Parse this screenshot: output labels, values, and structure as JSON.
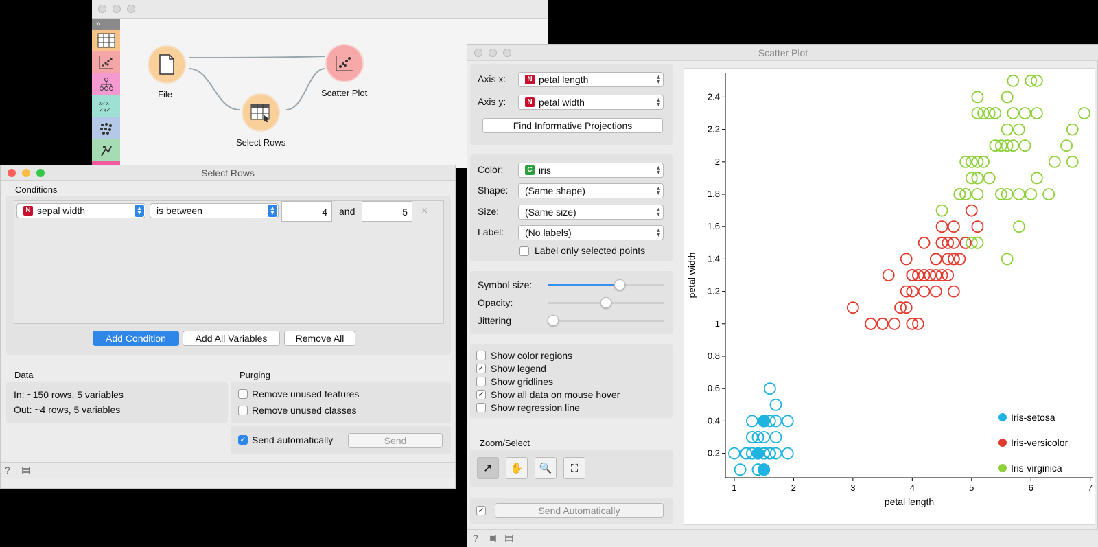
{
  "canvas": {
    "nodes": {
      "file": "File",
      "select_rows": "Select Rows",
      "scatter_plot": "Scatter Plot"
    }
  },
  "select_rows": {
    "title": "Select Rows",
    "conditions_label": "Conditions",
    "condition": {
      "variable": "sepal width",
      "operator": "is between",
      "value_from": "4",
      "and_label": "and",
      "value_to": "5",
      "remove": "×"
    },
    "buttons": {
      "add_condition": "Add Condition",
      "add_all": "Add All Variables",
      "remove_all": "Remove All"
    },
    "data": {
      "label": "Data",
      "in": "In: ~150 rows, 5 variables",
      "out": "Out: ~4 rows, 5 variables"
    },
    "purging": {
      "label": "Purging",
      "features": "Remove unused features",
      "classes": "Remove unused classes"
    },
    "send_auto": "Send automatically",
    "send": "Send"
  },
  "scatter": {
    "title": "Scatter Plot",
    "axis_x_label": "Axis x:",
    "axis_x": "petal length",
    "axis_y_label": "Axis y:",
    "axis_y": "petal width",
    "find_projections": "Find Informative Projections",
    "color_label": "Color:",
    "color": "iris",
    "shape_label": "Shape:",
    "shape": "(Same shape)",
    "size_label": "Size:",
    "size": "(Same size)",
    "label_label": "Label:",
    "label": "(No labels)",
    "label_selected": "Label only selected points",
    "symbol_size": "Symbol size:",
    "opacity": "Opacity:",
    "jittering": "Jittering",
    "symbol_size_value": 0.62,
    "opacity_value": 0.5,
    "jittering_value": 0.0,
    "show_color_regions": "Show color regions",
    "show_legend": "Show legend",
    "show_gridlines": "Show gridlines",
    "show_all_data": "Show all data on mouse hover",
    "show_regression": "Show regression line",
    "zoom_select": "Zoom/Select",
    "send_auto": "Send Automatically"
  },
  "colors": {
    "setosa": "#1fb3e0",
    "versicolor": "#e23b2e",
    "virginica": "#8ed13a",
    "accent": "#2f86e9"
  },
  "chart_data": {
    "type": "scatter",
    "xlabel": "petal length",
    "ylabel": "petal width",
    "xlim": [
      0.85,
      7.05
    ],
    "ylim": [
      0.05,
      2.55
    ],
    "xticks": [
      "1",
      "2",
      "3",
      "4",
      "5",
      "6",
      "7"
    ],
    "yticks": [
      "0.2",
      "0.4",
      "0.6",
      "0.8",
      "1",
      "1.2",
      "1.4",
      "1.6",
      "1.8",
      "2",
      "2.2",
      "2.4"
    ],
    "legend": [
      "Iris-setosa",
      "Iris-versicolor",
      "Iris-virginica"
    ],
    "legend_position": "bottom-right",
    "series": [
      {
        "name": "Iris-setosa",
        "x": [
          1.4,
          1.4,
          1.3,
          1.5,
          1.4,
          1.7,
          1.4,
          1.5,
          1.4,
          1.5,
          1.5,
          1.6,
          1.4,
          1.1,
          1.2,
          1.5,
          1.3,
          1.4,
          1.7,
          1.5,
          1.7,
          1.5,
          1.0,
          1.7,
          1.9,
          1.6,
          1.6,
          1.5,
          1.4,
          1.6,
          1.6,
          1.5,
          1.5,
          1.4,
          1.5,
          1.2,
          1.3,
          1.4,
          1.3,
          1.5,
          1.3,
          1.3,
          1.3,
          1.6,
          1.9,
          1.4,
          1.6,
          1.4,
          1.5,
          1.4
        ],
        "y": [
          0.2,
          0.2,
          0.2,
          0.2,
          0.2,
          0.4,
          0.3,
          0.2,
          0.2,
          0.1,
          0.2,
          0.2,
          0.1,
          0.1,
          0.2,
          0.4,
          0.4,
          0.3,
          0.3,
          0.3,
          0.2,
          0.4,
          0.2,
          0.5,
          0.2,
          0.2,
          0.4,
          0.2,
          0.2,
          0.2,
          0.2,
          0.4,
          0.1,
          0.2,
          0.2,
          0.2,
          0.2,
          0.1,
          0.2,
          0.2,
          0.3,
          0.3,
          0.2,
          0.6,
          0.4,
          0.3,
          0.2,
          0.2,
          0.2,
          0.2
        ]
      },
      {
        "name": "Iris-versicolor",
        "x": [
          4.7,
          4.5,
          4.9,
          4.0,
          4.6,
          4.5,
          4.7,
          3.3,
          4.6,
          3.9,
          3.5,
          4.2,
          4.0,
          4.7,
          3.6,
          4.4,
          4.5,
          4.1,
          4.5,
          3.9,
          4.8,
          4.0,
          4.9,
          4.7,
          4.3,
          4.4,
          4.8,
          5.0,
          4.5,
          3.5,
          3.8,
          3.7,
          3.9,
          5.1,
          4.5,
          4.5,
          4.7,
          4.4,
          4.1,
          4.0,
          4.4,
          4.6,
          4.0,
          3.3,
          4.2,
          4.2,
          4.2,
          4.3,
          3.0,
          4.1
        ],
        "y": [
          1.4,
          1.5,
          1.5,
          1.3,
          1.5,
          1.3,
          1.6,
          1.0,
          1.3,
          1.4,
          1.0,
          1.5,
          1.0,
          1.4,
          1.3,
          1.4,
          1.5,
          1.0,
          1.5,
          1.1,
          1.8,
          1.3,
          1.5,
          1.2,
          1.3,
          1.4,
          1.4,
          1.7,
          1.5,
          1.0,
          1.1,
          1.0,
          1.2,
          1.6,
          1.5,
          1.6,
          1.5,
          1.3,
          1.3,
          1.3,
          1.2,
          1.4,
          1.2,
          1.0,
          1.3,
          1.2,
          1.3,
          1.3,
          1.1,
          1.3
        ]
      },
      {
        "name": "Iris-virginica",
        "x": [
          6.0,
          5.1,
          5.9,
          5.6,
          5.8,
          6.6,
          4.5,
          6.3,
          5.8,
          6.1,
          5.1,
          5.3,
          5.5,
          5.0,
          5.1,
          5.3,
          5.5,
          6.7,
          6.9,
          5.0,
          5.7,
          4.9,
          6.7,
          4.9,
          5.7,
          6.0,
          4.8,
          4.9,
          5.6,
          5.8,
          6.1,
          6.4,
          5.6,
          5.1,
          5.6,
          6.1,
          5.6,
          5.5,
          4.8,
          5.4,
          5.6,
          5.1,
          5.1,
          5.9,
          5.7,
          5.2,
          5.0,
          5.2,
          5.4,
          5.1
        ],
        "y": [
          2.5,
          1.9,
          2.1,
          1.8,
          2.2,
          2.1,
          1.7,
          1.8,
          1.8,
          2.5,
          2.0,
          1.9,
          2.1,
          2.0,
          2.4,
          2.3,
          1.8,
          2.2,
          2.3,
          1.5,
          2.3,
          2.0,
          2.0,
          1.8,
          2.1,
          1.8,
          1.8,
          1.8,
          2.1,
          1.6,
          1.9,
          2.0,
          2.2,
          1.5,
          1.4,
          2.3,
          2.4,
          1.8,
          1.8,
          2.1,
          2.4,
          2.3,
          1.9,
          2.3,
          2.5,
          2.3,
          1.9,
          2.0,
          2.3,
          1.8
        ]
      }
    ]
  }
}
